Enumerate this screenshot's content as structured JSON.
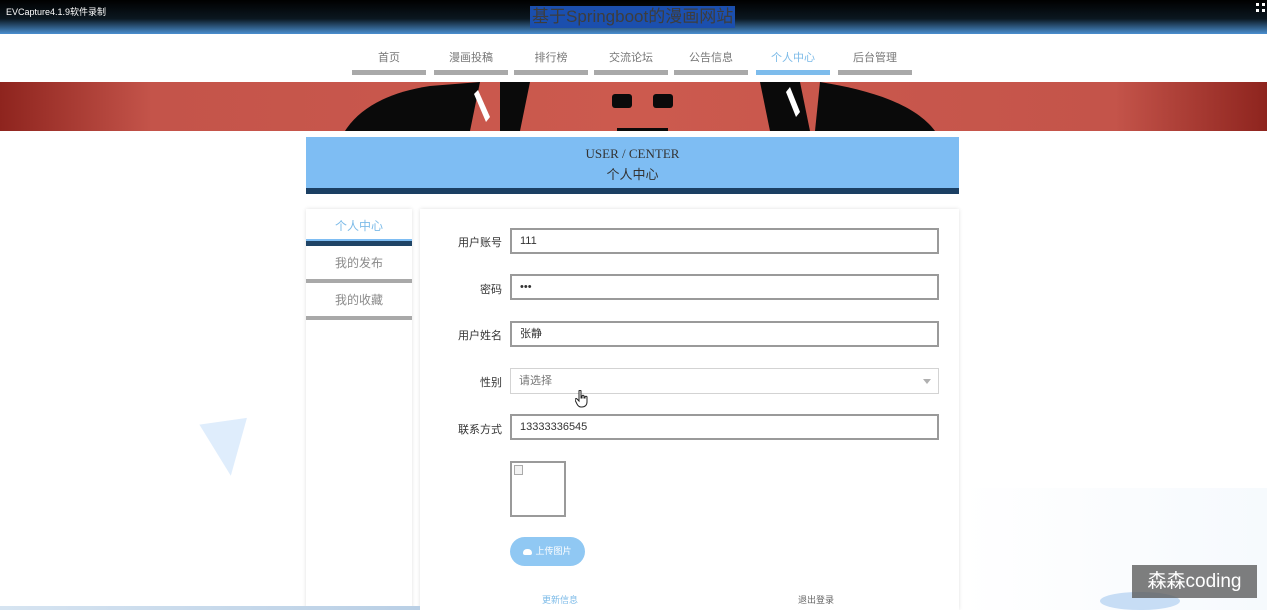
{
  "capture_label": "EVCapture4.1.9软件录制",
  "site_title": "基于Springboot的漫画网站",
  "nav": {
    "items": [
      {
        "label": "首页"
      },
      {
        "label": "漫画投稿"
      },
      {
        "label": "排行榜"
      },
      {
        "label": "交流论坛"
      },
      {
        "label": "公告信息"
      },
      {
        "label": "个人中心"
      },
      {
        "label": "后台管理"
      }
    ],
    "active": "个人中心"
  },
  "header": {
    "en": "USER / CENTER",
    "cn": "个人中心"
  },
  "side_menu": {
    "items": [
      {
        "label": "个人中心"
      },
      {
        "label": "我的发布"
      },
      {
        "label": "我的收藏"
      }
    ],
    "active": "个人中心"
  },
  "form": {
    "account_label": "用户账号",
    "account_value": "111",
    "password_label": "密码",
    "password_value": "•••",
    "name_label": "用户姓名",
    "name_value": "张静",
    "gender_label": "性别",
    "gender_placeholder": "请选择",
    "phone_label": "联系方式",
    "phone_value": "13333336545",
    "upload_label": "上传图片",
    "update_label": "更新信息",
    "logout_label": "退出登录"
  },
  "watermark": "森森coding",
  "colors": {
    "accent": "#7ebdf3",
    "header_border": "#1b3f63",
    "banner": "#cc5a4e",
    "active_text": "#7dbbe8"
  }
}
